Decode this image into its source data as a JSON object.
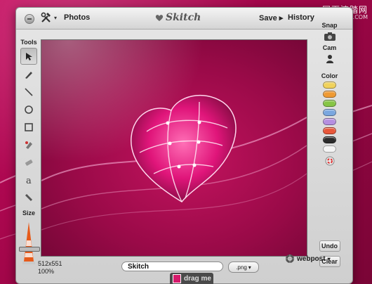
{
  "watermark": {
    "line1": "网页溶踏网",
    "line2": "www.WEBJX.COM"
  },
  "titlebar": {
    "photos_label": "Photos",
    "brand": "Skitch",
    "save_label": "Save",
    "save_arrow": "▸",
    "history_label": "History"
  },
  "left_rail": {
    "tools_label": "Tools",
    "tools": [
      "arrow-icon",
      "pen-icon",
      "line-icon",
      "ellipse-icon",
      "rectangle-icon",
      "highlighter-icon",
      "eraser-icon",
      "text-icon",
      "marker-icon"
    ],
    "size_label": "Size",
    "size_level": 0.35
  },
  "right_rail": {
    "snap_label": "Snap",
    "cam_label": "Cam",
    "color_label": "Color",
    "swatches": [
      "#f0d25c",
      "#ef9a33",
      "#86c545",
      "#7aa7df",
      "#b58fe0",
      "#e8573a",
      "#2b2b2b",
      "#f4f4f4"
    ],
    "undo_label": "Undo",
    "clear_label": "Clear"
  },
  "status": {
    "dimensions": "512x551",
    "zoom": "100%",
    "filename": "Skitch",
    "format": ".png",
    "format_arrow": "▾",
    "webpost_label": "webpost",
    "webpost_arrow": "▾",
    "drag_label": "drag me"
  }
}
